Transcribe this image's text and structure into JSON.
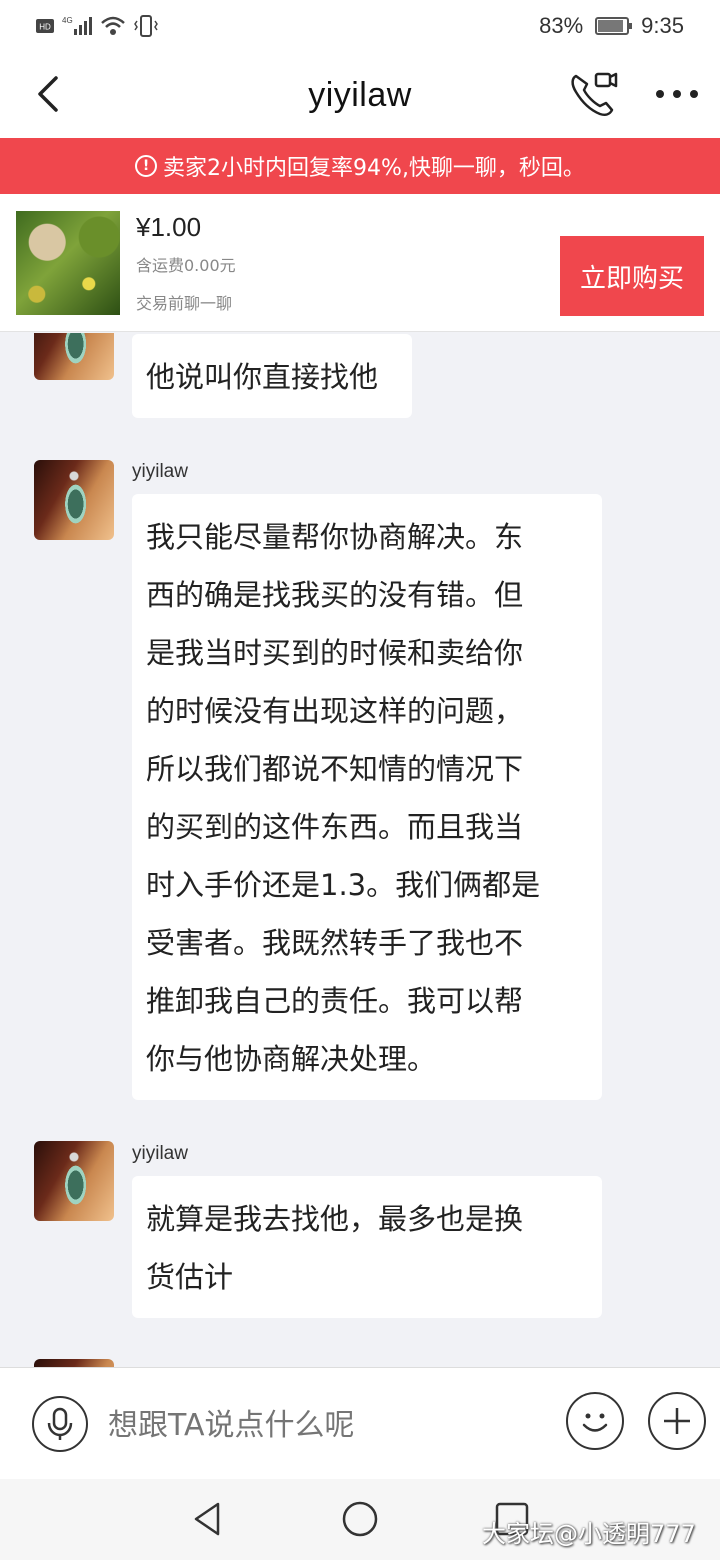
{
  "status_bar": {
    "left_icons": [
      "hd-icon",
      "signal-4g-icon",
      "wifi-icon",
      "vibrate-icon"
    ],
    "battery": "83%",
    "time": "9:35"
  },
  "header": {
    "title": "yiyilaw"
  },
  "notice": {
    "text": "卖家2小时内回复率94%,快聊一聊，秒回。"
  },
  "product": {
    "price": "¥1.00",
    "shipping": "含运费0.00元",
    "note": "交易前聊一聊",
    "buy_label": "立即购买"
  },
  "messages": [
    {
      "sender": "",
      "text": "他说叫你直接找他"
    },
    {
      "sender": "yiyilaw",
      "text": "我只能尽量帮你协商解决。东\n西的确是找我买的没有错。但\n是我当时买到的时候和卖给你\n的时候没有出现这样的问题，\n所以我们都说不知情的情况下\n的买到的这件东西。而且我当\n时入手价还是1.3。我们俩都是\n受害者。我既然转手了我也不\n推卸我自己的责任。我可以帮\n你与他协商解决处理。"
    },
    {
      "sender": "yiyilaw",
      "text": "就算是我去找他，最多也是换\n货估计"
    }
  ],
  "input": {
    "placeholder": "想跟TA说点什么呢"
  },
  "watermark": "大家坛@小透明777",
  "colors": {
    "accent": "#f0474d",
    "background": "#f1f2f6"
  }
}
